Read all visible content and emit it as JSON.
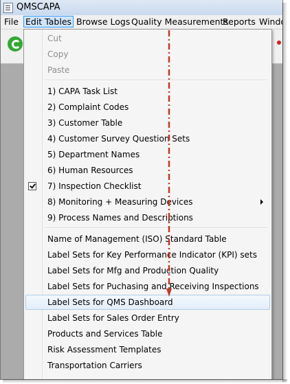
{
  "window": {
    "title": "QMSCAPA"
  },
  "menubar": {
    "items": [
      {
        "label": "File"
      },
      {
        "label": "Edit Tables"
      },
      {
        "label": "Browse Logs"
      },
      {
        "label": "Quality Measurements"
      },
      {
        "label": "Reports"
      },
      {
        "label": "Windo"
      }
    ]
  },
  "toolbar": {
    "icons": [
      "go-icon"
    ]
  },
  "dropdown": {
    "clipboard": [
      {
        "label": "Cut"
      },
      {
        "label": "Copy"
      },
      {
        "label": "Paste"
      }
    ],
    "tables": [
      {
        "label": "1) CAPA Task List"
      },
      {
        "label": "2) Complaint Codes"
      },
      {
        "label": "3) Customer Table"
      },
      {
        "label": "4) Customer Survey Question Sets"
      },
      {
        "label": "5) Department Names"
      },
      {
        "label": "6) Human Resources"
      },
      {
        "label": "7) Inspection Checklist",
        "checked": true
      },
      {
        "label": "8) Monitoring + Measuring Devices",
        "submenu": true
      },
      {
        "label": "9) Process Names and Descriptions"
      }
    ],
    "labels": [
      {
        "label": "Name of Management (ISO) Standard Table"
      },
      {
        "label": "Label Sets for Key Performance Indicator (KPI) sets"
      },
      {
        "label": "Label Sets for Mfg and Production Quality"
      },
      {
        "label": "Label Sets for Puchasing and Receiving Inspections"
      },
      {
        "label": "Label Sets for QMS Dashboard",
        "highlighted": true
      },
      {
        "label": "Label Sets for Sales Order Entry"
      },
      {
        "label": "Products and Services Table"
      },
      {
        "label": "Risk Assessment Templates"
      },
      {
        "label": "Transportation Carriers"
      }
    ]
  },
  "colors": {
    "highlight_border": "#b1cbe6",
    "active_menu_border": "#3399ff",
    "annotation_arrow": "#c0392b"
  }
}
